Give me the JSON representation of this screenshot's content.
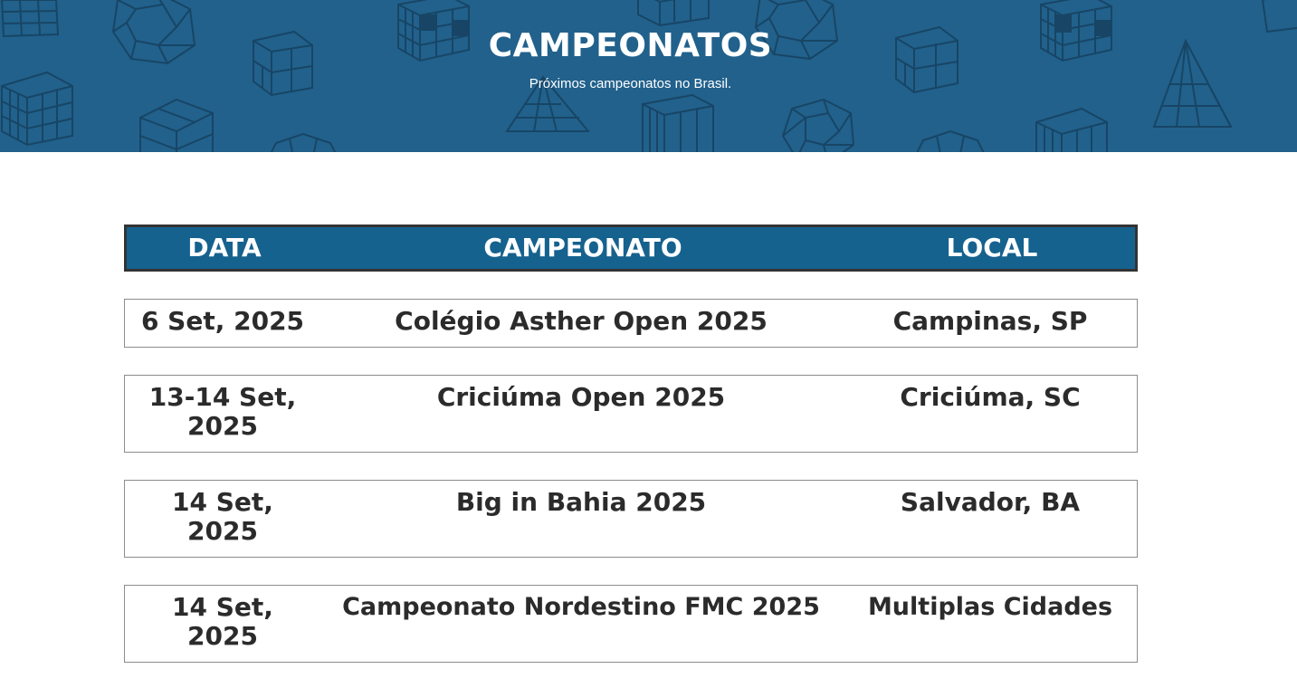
{
  "banner": {
    "title": "CAMPEONATOS",
    "subtitle": "Próximos campeonatos no Brasil.",
    "background_color": "#21618c",
    "pattern_icons": [
      "cube-3x3-icon",
      "cube-2x2-icon",
      "megaminx-icon",
      "pyraminx-icon",
      "skewb-icon"
    ]
  },
  "table": {
    "header_color": "#15628f",
    "headers": {
      "date": "DATA",
      "championship": "CAMPEONATO",
      "location": "LOCAL"
    },
    "rows": [
      {
        "date": "6 Set, 2025",
        "championship": "Colégio Asther Open 2025",
        "location": "Campinas, SP"
      },
      {
        "date": "13-14 Set, 2025",
        "championship": "Criciúma Open 2025",
        "location": "Criciúma, SC"
      },
      {
        "date": "14 Set, 2025",
        "championship": "Big in Bahia 2025",
        "location": "Salvador, BA"
      },
      {
        "date": "14 Set, 2025",
        "championship": "Campeonato Nordestino FMC 2025",
        "location": "Multiplas Cidades"
      }
    ]
  }
}
